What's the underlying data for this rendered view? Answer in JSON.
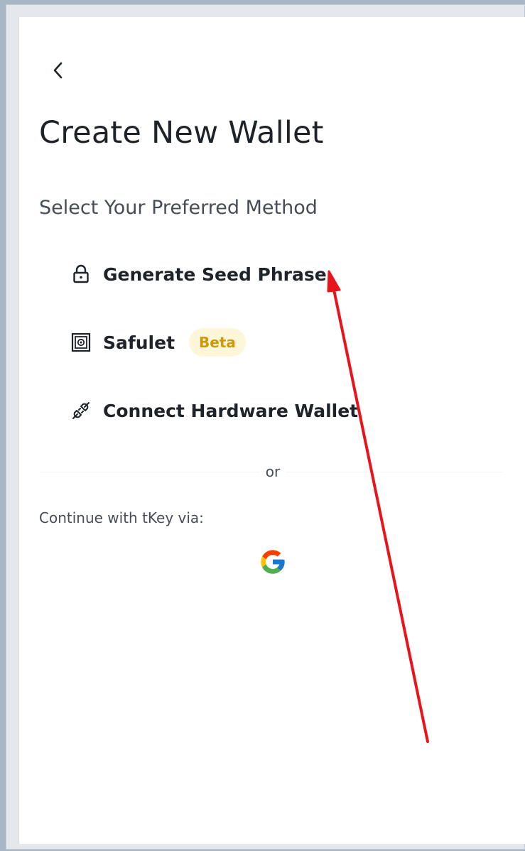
{
  "header": {
    "back_icon": "chevron-left-icon",
    "title": "Create New Wallet"
  },
  "methods": {
    "heading": "Select Your Preferred Method",
    "items": [
      {
        "label": "Generate Seed Phrase",
        "icon": "lock-icon"
      },
      {
        "label": "Safulet",
        "icon": "safe-icon",
        "badge": "Beta"
      },
      {
        "label": "Connect Hardware Wallet",
        "icon": "plug-icon"
      }
    ]
  },
  "alt": {
    "or_text": "or",
    "tkey_label": "Continue with tKey via:",
    "google_icon": "google-icon"
  },
  "colors": {
    "title": "#1e2329",
    "secondary_text": "#474d57",
    "badge_bg": "#fef6d8",
    "badge_text": "#d0980b",
    "annotation_arrow": "#e8141c"
  }
}
